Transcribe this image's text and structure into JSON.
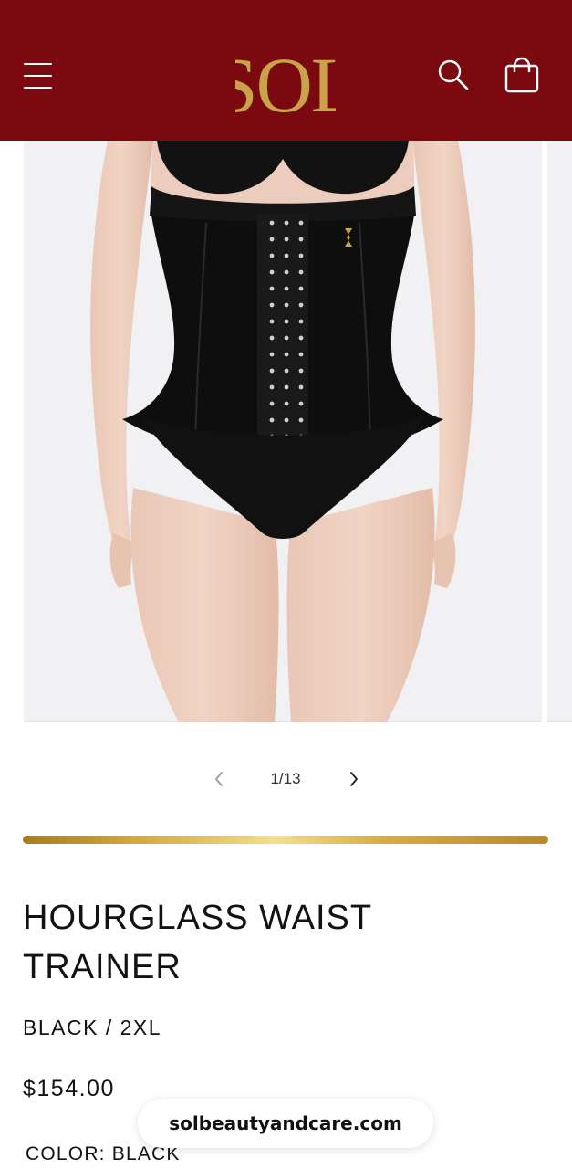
{
  "header": {
    "brand": "SOL",
    "menu_icon": "hamburger-menu-icon",
    "search_icon": "search-icon",
    "cart_icon": "shopping-bag-icon",
    "background_color": "#7a0a0f",
    "logo_color": "#c9a24a"
  },
  "gallery": {
    "current": "1",
    "total": "13",
    "counter": "1/13",
    "prev_icon": "chevron-left-icon",
    "next_icon": "chevron-right-icon"
  },
  "product": {
    "title": "HOURGLASS WAIST TRAINER",
    "variant": "BLACK / 2XL",
    "price": "$154.00",
    "color_label": "COLOR: BLACK"
  },
  "browser": {
    "url": "solbeautyandcare.com"
  },
  "colors": {
    "accent_gold": "#d4a93e",
    "text": "#121212"
  }
}
